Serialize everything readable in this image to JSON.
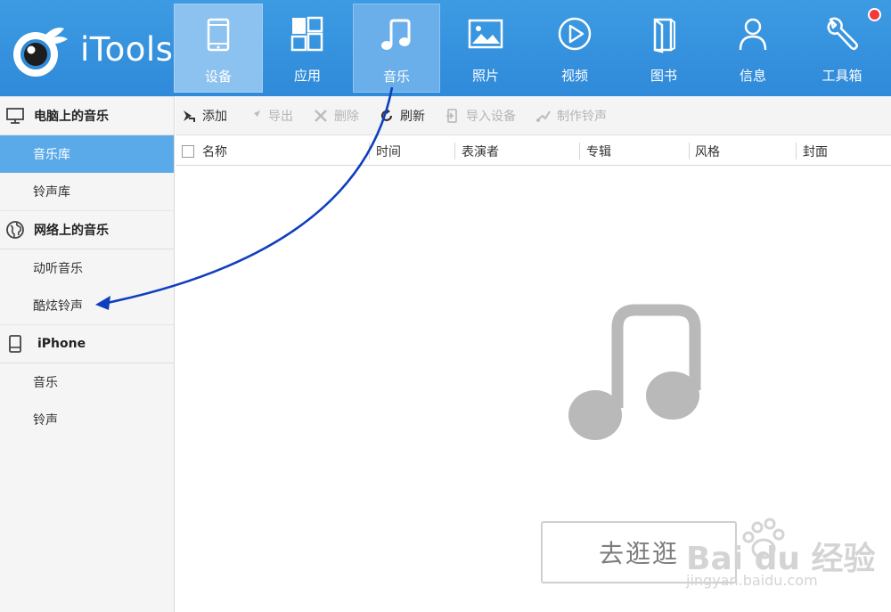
{
  "app": {
    "name": "iTools"
  },
  "nav": {
    "tabs": [
      {
        "id": "device",
        "label": "设备",
        "icon": "tablet-icon"
      },
      {
        "id": "apps",
        "label": "应用",
        "icon": "apps-grid-icon"
      },
      {
        "id": "music",
        "label": "音乐",
        "icon": "music-note-icon"
      },
      {
        "id": "photos",
        "label": "照片",
        "icon": "photo-icon"
      },
      {
        "id": "video",
        "label": "视频",
        "icon": "play-circle-icon"
      },
      {
        "id": "books",
        "label": "图书",
        "icon": "book-icon"
      },
      {
        "id": "info",
        "label": "信息",
        "icon": "user-icon"
      },
      {
        "id": "toolbox",
        "label": "工具箱",
        "icon": "wrench-icon"
      }
    ],
    "active": "music"
  },
  "sidebar": {
    "sections": [
      {
        "title": "电脑上的音乐",
        "icon": "monitor-icon",
        "items": [
          "音乐库",
          "铃声库"
        ]
      },
      {
        "title": "网络上的音乐",
        "icon": "globe-icon",
        "items": [
          "动听音乐",
          "酷炫铃声"
        ]
      },
      {
        "title": "iPhone",
        "icon": "phone-icon",
        "items": [
          "音乐",
          "铃声"
        ]
      }
    ],
    "active_item": "音乐库"
  },
  "toolbar": {
    "add": "添加",
    "export": "导出",
    "delete": "删除",
    "refresh": "刷新",
    "import_device": "导入设备",
    "make_ringtone": "制作铃声"
  },
  "table": {
    "columns": [
      "名称",
      "时间",
      "表演者",
      "专辑",
      "风格",
      "封面"
    ]
  },
  "empty_state": {
    "button_label": "去逛逛"
  },
  "watermark": {
    "brand": "Bai du 经验",
    "url": "jingyan.baidu.com"
  },
  "colors": {
    "header_blue": "#3d9be3",
    "active_tab": "#6aafea",
    "sidebar_active": "#5aaaea",
    "annotation_arrow": "#0f3fbf",
    "notify_red": "#f23a3a"
  }
}
